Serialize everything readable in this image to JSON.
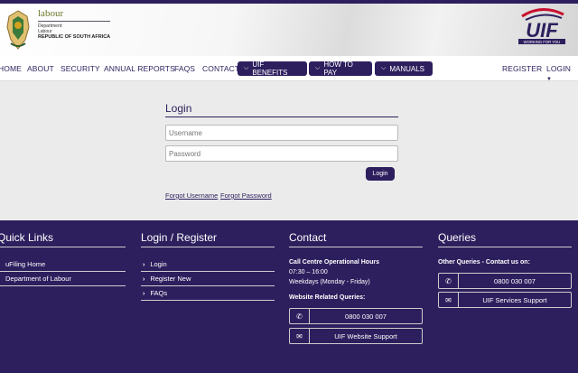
{
  "header": {
    "dept_title": "labour",
    "dept_sub1": "Department:",
    "dept_sub2": "Labour",
    "dept_country": "REPUBLIC OF SOUTH AFRICA",
    "logo_text": "UIF",
    "logo_tagline": "WORKING FOR YOU"
  },
  "nav": {
    "home": "HOME",
    "about": "ABOUT",
    "security": "SECURITY",
    "annual_reports": "ANNUAL REPORTS",
    "faqs": "FAQS",
    "contact": "CONTACT",
    "uif_benefits": "UIF BENEFITS",
    "how_to_pay": "HOW TO PAY",
    "manuals": "MANUALS",
    "register": "REGISTER",
    "login": "LOGIN"
  },
  "login": {
    "title": "Login",
    "username_placeholder": "Username",
    "password_placeholder": "Password",
    "button": "Login",
    "forgot_username": "Forgot Username",
    "forgot_password": "Forgot Password"
  },
  "footer": {
    "quick_links": {
      "title": "Quick Links",
      "items": [
        "uFiling Home",
        "Department of Labour"
      ]
    },
    "login_register": {
      "title": "Login / Register",
      "items": [
        "Login",
        "Register New",
        "FAQs"
      ]
    },
    "contact": {
      "title": "Contact",
      "hours_title": "Call Centre Operational Hours",
      "hours": "07:30 – 16:00",
      "days": "Weekdays (Monday - Friday)",
      "web_title": "Website Related Queries:",
      "phone": "0800 030 007",
      "support": "UIF Website Support"
    },
    "queries": {
      "title": "Queries",
      "other": "Other Queries - Contact us on:",
      "phone": "0800 030 007",
      "support": "UIF Services Support"
    }
  },
  "colors": {
    "brand": "#2d1f5e",
    "accent_red": "#c8102e"
  }
}
